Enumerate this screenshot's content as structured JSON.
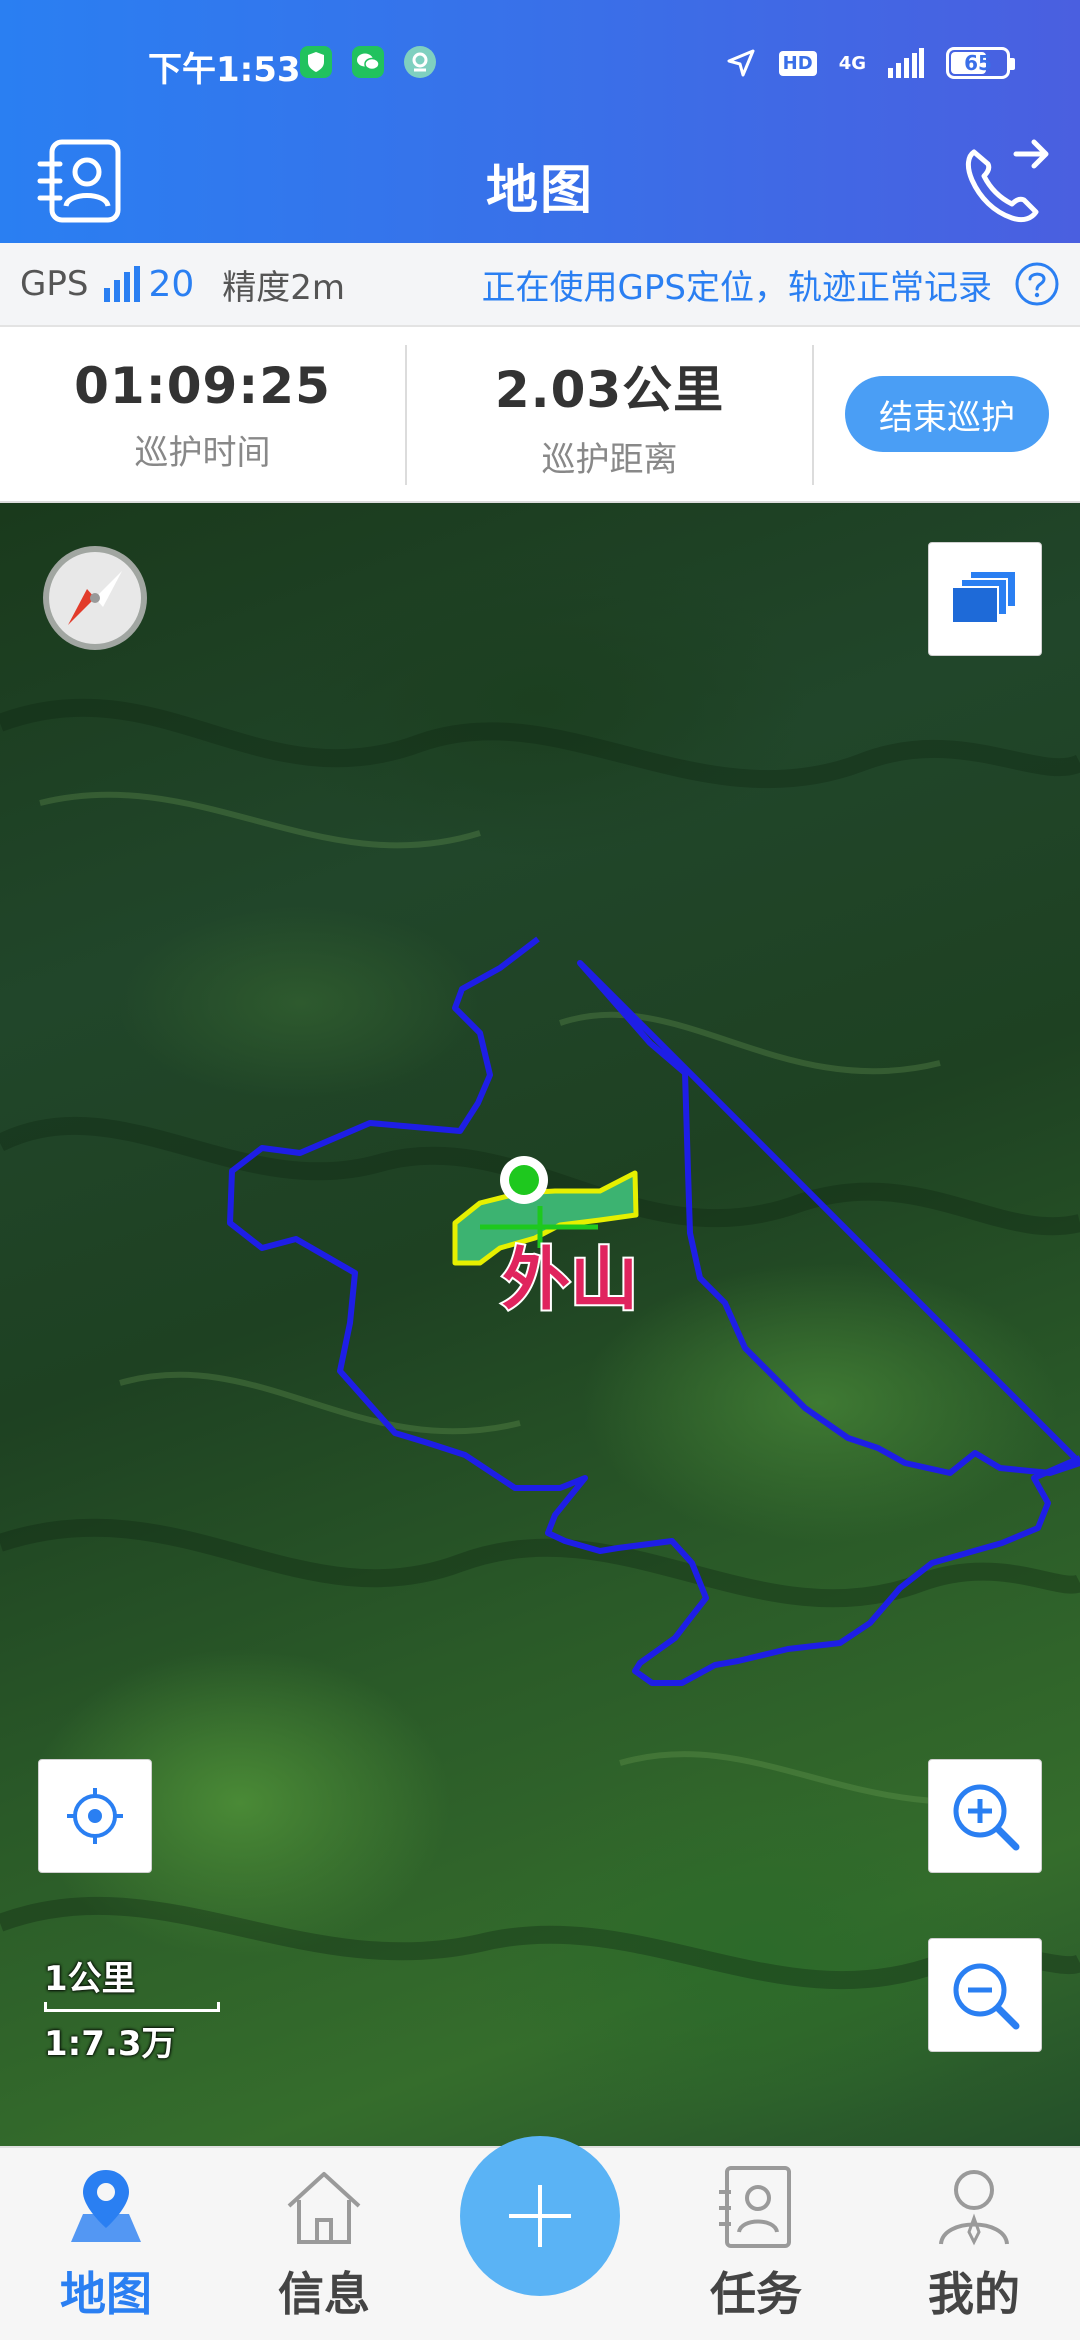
{
  "status_bar": {
    "time": "下午1:53",
    "network": "4G",
    "hd": "HD",
    "battery": "65",
    "battery_level": 0.65
  },
  "header": {
    "title": "地图",
    "left_icon": "patrol-contact-icon",
    "right_icon": "phone-forward-icon"
  },
  "gps": {
    "label": "GPS",
    "satellites": "20",
    "accuracy": "精度2m",
    "status_text": "正在使用GPS定位，轨迹正常记录",
    "help_icon": "help-icon"
  },
  "patrol": {
    "time_value": "01:09:25",
    "time_label": "巡护时间",
    "distance_value": "2.03公里",
    "distance_label": "巡护距离",
    "end_button": "结束巡护"
  },
  "map": {
    "area_label": "外山",
    "scale_distance": "1公里",
    "scale_ratio": "1:7.3万",
    "boundary_color": "#1e1ee6",
    "zone_fill_color": "#3cb371",
    "zone_outline_color": "#e6f000",
    "area_label_color": "#e0245e",
    "location_dot_color": "#1ec81e"
  },
  "nav": {
    "items": [
      {
        "label": "地图",
        "icon": "map-pin-icon",
        "active": true
      },
      {
        "label": "信息",
        "icon": "home-icon",
        "active": false
      },
      {
        "label": "任务",
        "icon": "task-icon",
        "active": false
      },
      {
        "label": "我的",
        "icon": "profile-icon",
        "active": false
      }
    ],
    "add_icon": "plus-icon"
  },
  "colors": {
    "header_gradient_start": "#2a7ff2",
    "header_gradient_end": "#4a5fe0",
    "accent": "#2a7ff2",
    "end_button": "#4a9ef5"
  }
}
